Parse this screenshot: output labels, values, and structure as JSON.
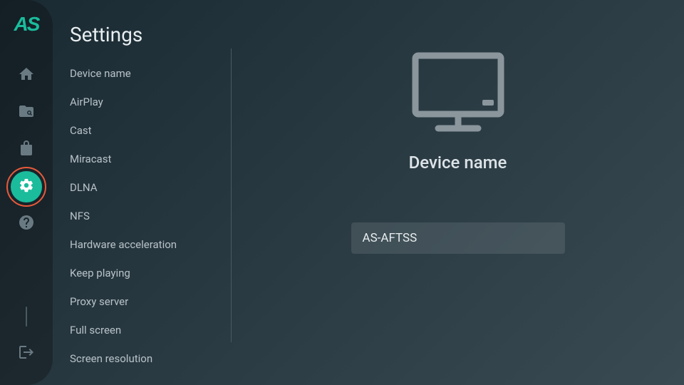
{
  "app": {
    "logo": "AS"
  },
  "nav": {
    "items": [
      {
        "id": "home",
        "icon": "home"
      },
      {
        "id": "library",
        "icon": "folder-search"
      },
      {
        "id": "store",
        "icon": "shopping-bag"
      },
      {
        "id": "settings",
        "icon": "gear",
        "selected": true
      },
      {
        "id": "help",
        "icon": "help-circle"
      }
    ],
    "exit": {
      "id": "exit",
      "icon": "logout"
    }
  },
  "settings": {
    "title": "Settings",
    "items": [
      {
        "label": "Device name"
      },
      {
        "label": "AirPlay"
      },
      {
        "label": "Cast"
      },
      {
        "label": "Miracast"
      },
      {
        "label": "DLNA"
      },
      {
        "label": "NFS"
      },
      {
        "label": "Hardware acceleration"
      },
      {
        "label": "Keep playing"
      },
      {
        "label": "Proxy server"
      },
      {
        "label": "Full screen"
      },
      {
        "label": "Screen resolution"
      }
    ]
  },
  "detail": {
    "title": "Device name",
    "value": "AS-AFTSS"
  }
}
